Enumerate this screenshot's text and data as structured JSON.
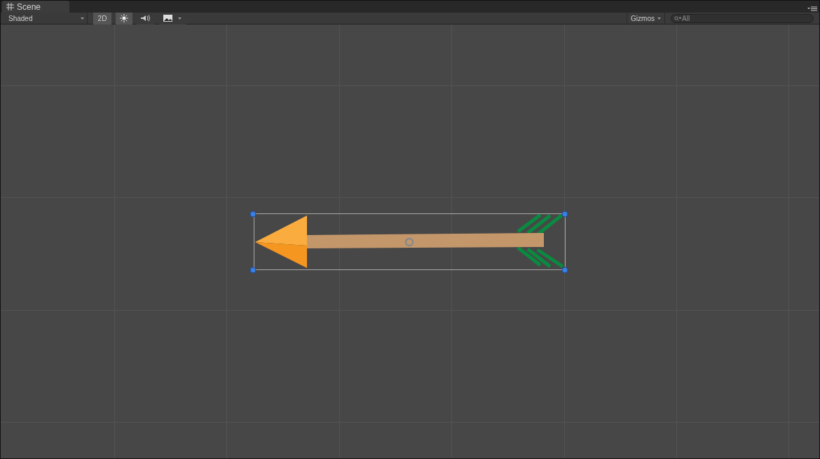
{
  "tab": {
    "label": "Scene",
    "selected": true
  },
  "toolbar": {
    "draw_mode": "Shaded",
    "toggles": [
      {
        "kind": "text",
        "label": "2D",
        "on": true
      },
      {
        "kind": "light",
        "on": true
      },
      {
        "kind": "audio",
        "on": false
      },
      {
        "kind": "effects",
        "on": false
      }
    ],
    "gizmos": "Gizmos",
    "search": {
      "placeholder": "All"
    }
  }
}
